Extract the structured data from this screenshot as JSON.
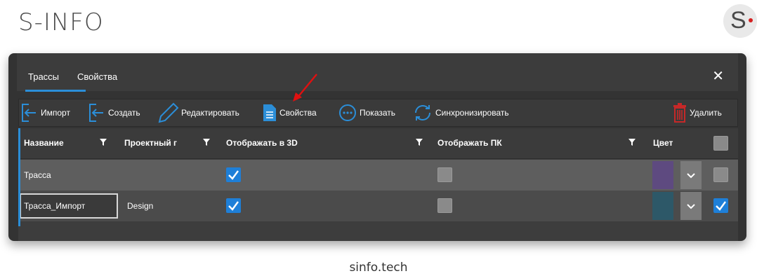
{
  "brand": {
    "title": "S-INFO",
    "logo_letter": "S"
  },
  "tabs": [
    {
      "label": "Трассы",
      "active": true
    },
    {
      "label": "Свойства",
      "active": false
    }
  ],
  "window": {
    "close": "✕"
  },
  "toolbar": {
    "import": "Импорт",
    "create": "Создать",
    "edit": "Редактировать",
    "properties": "Свойства",
    "show": "Показать",
    "sync": "Синхронизировать",
    "delete": "Удалить"
  },
  "columns": {
    "name": "Название",
    "project": "Проектный г",
    "show3d": "Отображать в 3D",
    "showpk": "Отображать ПК",
    "color": "Цвет"
  },
  "rows": [
    {
      "name": "Трасса",
      "project": "",
      "show3d": true,
      "showpk": false,
      "color": "#5e4a80",
      "visible": false
    },
    {
      "name": "Трасса_Импорт",
      "project": "Design",
      "show3d": true,
      "showpk": false,
      "color": "#2d5868",
      "visible": true
    }
  ],
  "footer": {
    "text": "sinfo.tech"
  },
  "colors": {
    "accent": "#2b8ed8",
    "checkbox_on": "#1e7fd8",
    "delete_red": "#c62828",
    "logo_dot": "#d42020"
  }
}
